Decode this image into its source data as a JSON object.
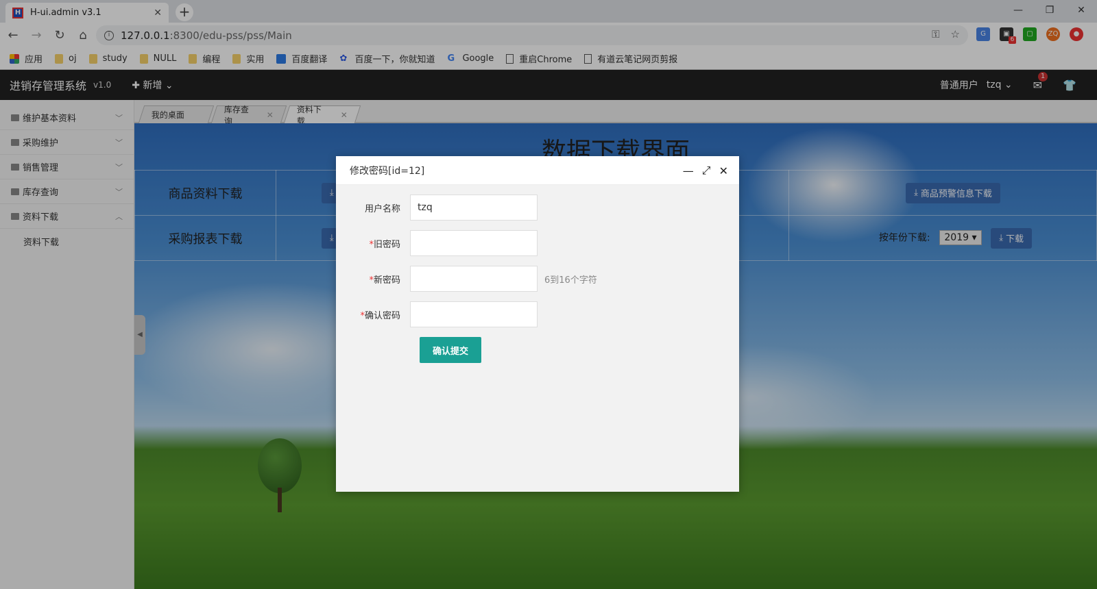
{
  "browser": {
    "tab_title": "H-ui.admin v3.1",
    "tab_close": "✕",
    "new_tab": "+",
    "favicon_text": "H",
    "url_host": "127.0.0.1",
    "url_rest": ":8300/edu-pss/pss/Main",
    "window_controls": [
      "—",
      "❐",
      "✕"
    ],
    "bookmarks": [
      {
        "label": "应用",
        "icon": "apps-icon"
      },
      {
        "label": "oj",
        "icon": "folder-icon"
      },
      {
        "label": "study",
        "icon": "folder-icon"
      },
      {
        "label": "NULL",
        "icon": "folder-icon"
      },
      {
        "label": "编程",
        "icon": "folder-icon"
      },
      {
        "label": "实用",
        "icon": "folder-icon"
      },
      {
        "label": "百度翻译",
        "icon": "translate-icon"
      },
      {
        "label": "百度一下，你就知道",
        "icon": "baidu-paw-icon"
      },
      {
        "label": "Google",
        "icon": "google-icon"
      },
      {
        "label": "重启Chrome",
        "icon": "page-icon"
      },
      {
        "label": "有道云笔记网页剪报",
        "icon": "page-icon"
      }
    ],
    "ext_badge": "6",
    "ext_zq": "ZQ"
  },
  "app": {
    "brand": "进销存管理系统",
    "version": "v1.0",
    "new_label": "新增",
    "user_role": "普通用户",
    "username": "tzq",
    "mail_badge": "1"
  },
  "sidebar": {
    "items": [
      {
        "label": "维护基本资料"
      },
      {
        "label": "采购维护"
      },
      {
        "label": "销售管理"
      },
      {
        "label": "库存查询"
      },
      {
        "label": "资料下载"
      }
    ],
    "sub_items": [
      "资料下载"
    ]
  },
  "page_tabs": [
    {
      "label": "我的桌面"
    },
    {
      "label": "库存查询"
    },
    {
      "label": "资料下载"
    }
  ],
  "page": {
    "title": "数据下载界面",
    "row1_label": "商品资料下载",
    "row2_label": "采购报表下载",
    "warning_btn": "商品预警信息下载",
    "year_label": "按年份下载:",
    "year_value": "2019",
    "download_btn": "下载"
  },
  "dialog": {
    "title": "修改密码[id=12]",
    "username_label": "用户名称",
    "username_value": "tzq",
    "old_pwd_label": "旧密码",
    "new_pwd_label": "新密码",
    "new_pwd_hint": "6到16个字符",
    "confirm_pwd_label": "确认密码",
    "required_mark": "*",
    "submit_label": "确认提交"
  },
  "colors": {
    "accent": "#1aa094",
    "topbar": "#222222",
    "download_btn": "#3a6ab0"
  }
}
